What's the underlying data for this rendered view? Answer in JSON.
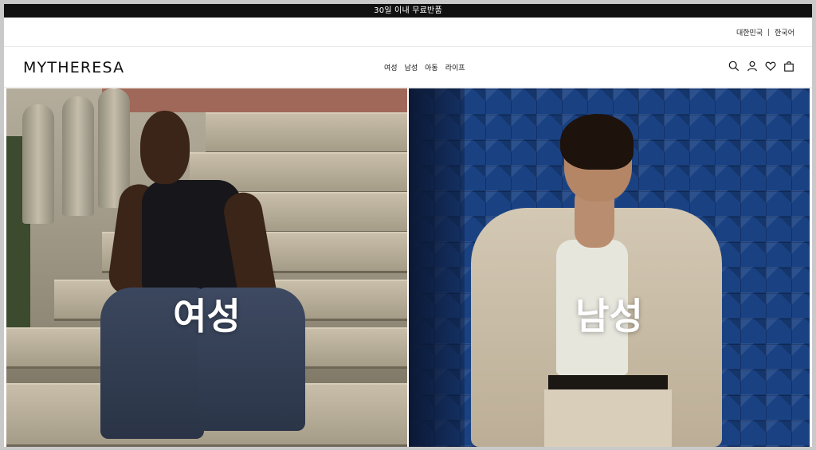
{
  "promo": {
    "text": "30일 이내 무료반품"
  },
  "utility": {
    "country": "대한민국",
    "separator": "|",
    "language": "한국어"
  },
  "header": {
    "logo": "MYTHERESA",
    "nav": [
      "여성",
      "남성",
      "아동",
      "라이프"
    ],
    "icons": [
      "search-icon",
      "account-icon",
      "wishlist-icon",
      "shopping-bag-icon"
    ]
  },
  "hero": {
    "panels": [
      {
        "label": "여성"
      },
      {
        "label": "남성"
      }
    ]
  }
}
